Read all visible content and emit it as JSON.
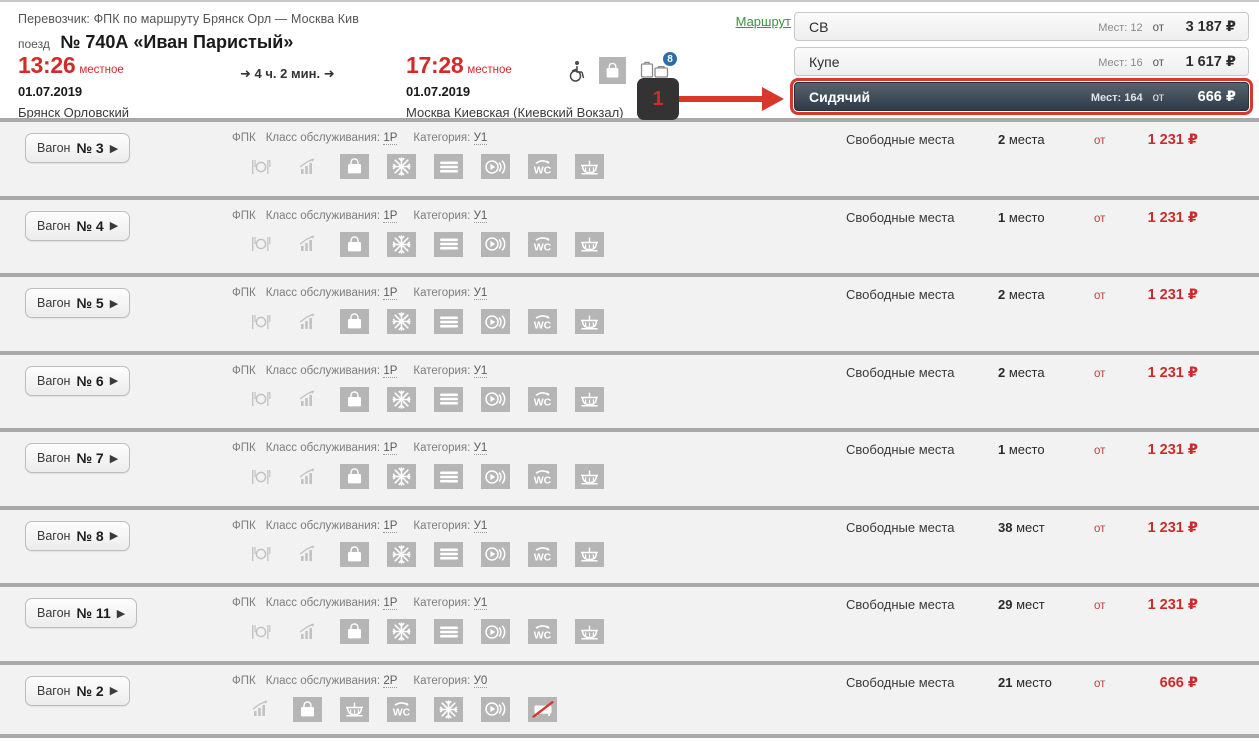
{
  "header": {
    "carrier_line": "Перевозчик: ФПК   по маршруту Брянск Орл — Москва Кив",
    "train_word": "поезд",
    "train_number_name": "№ 740А «Иван Паристый»",
    "route_link": "Маршрут",
    "departure": {
      "time": "13:26",
      "time_suffix": "местное",
      "date": "01.07.2019",
      "station": "Брянск Орловский"
    },
    "arrival": {
      "time": "17:28",
      "time_suffix": "местное",
      "date": "01.07.2019",
      "station": "Москва Киевская (Киевский Вокзал)"
    },
    "duration": "4 ч. 2 мин.",
    "facility_icons": [
      {
        "name": "wheelchair-accessible-icon",
        "glyph": "♿"
      },
      {
        "name": "luggage-icon",
        "glyph": "🛍"
      },
      {
        "name": "baggage-icon",
        "glyph": "🧳",
        "badge": "8"
      }
    ],
    "step_marker": "1"
  },
  "class_panel": {
    "seats_label": "Мест:",
    "from_label": "от",
    "currency": "₽",
    "options": [
      {
        "name": "СВ",
        "seats": "12",
        "price": "3 187",
        "selected": false
      },
      {
        "name": "Купе",
        "seats": "16",
        "price": "1 617",
        "selected": false
      },
      {
        "name": "Сидячий",
        "seats": "164",
        "price": "666",
        "selected": true
      }
    ]
  },
  "wagon_list": {
    "wagon_word": "Вагон",
    "carrier_short": "ФПК",
    "class_label": "Класс обслуживания:",
    "category_label": "Категория:",
    "free_seats_label": "Свободные места",
    "from_label": "от",
    "currency": "₽",
    "rows": [
      {
        "wagon": "№ 3",
        "service_class": "1Р",
        "category": "У1",
        "seats": "2 места",
        "seats_num": "2",
        "seats_word": "места",
        "price": "1 231",
        "icon_set": "A"
      },
      {
        "wagon": "№ 4",
        "service_class": "1Р",
        "category": "У1",
        "seats": "1 место",
        "seats_num": "1",
        "seats_word": "место",
        "price": "1 231",
        "icon_set": "A"
      },
      {
        "wagon": "№ 5",
        "service_class": "1Р",
        "category": "У1",
        "seats": "2 места",
        "seats_num": "2",
        "seats_word": "места",
        "price": "1 231",
        "icon_set": "A"
      },
      {
        "wagon": "№ 6",
        "service_class": "1Р",
        "category": "У1",
        "seats": "2 места",
        "seats_num": "2",
        "seats_word": "места",
        "price": "1 231",
        "icon_set": "A"
      },
      {
        "wagon": "№ 7",
        "service_class": "1Р",
        "category": "У1",
        "seats": "1 место",
        "seats_num": "1",
        "seats_word": "место",
        "price": "1 231",
        "icon_set": "A"
      },
      {
        "wagon": "№ 8",
        "service_class": "1Р",
        "category": "У1",
        "seats": "38 мест",
        "seats_num": "38",
        "seats_word": "мест",
        "price": "1 231",
        "icon_set": "A"
      },
      {
        "wagon": "№ 11",
        "service_class": "1Р",
        "category": "У1",
        "seats": "29 мест",
        "seats_num": "29",
        "seats_word": "мест",
        "price": "1 231",
        "icon_set": "A"
      },
      {
        "wagon": "№ 2",
        "service_class": "2Р",
        "category": "У0",
        "seats": "21 место",
        "seats_num": "21",
        "seats_word": "место",
        "price": "666",
        "icon_set": "B"
      }
    ],
    "icon_sets": {
      "A": [
        "restaurant-icon",
        "wifi-signal-icon",
        "luggage-storage-icon",
        "air-conditioning-icon",
        "bedding-icon",
        "audio-entertainment-icon",
        "wc-icon",
        "shower-icon"
      ],
      "B": [
        "wifi-signal-icon",
        "luggage-storage-icon",
        "shower-icon",
        "wc-icon",
        "air-conditioning-icon",
        "audio-entertainment-icon",
        "no-pets-icon"
      ]
    }
  },
  "colors": {
    "price_red": "#cc2b2b",
    "time_red": "#d22b2b",
    "link_green": "#3d9141",
    "highlight_red": "#d8372c",
    "selected_dark": "#2f3b46",
    "icon_gray": "#b5b5b5",
    "row_bg": "#f2f2f2",
    "separator": "#a9a9a9"
  }
}
